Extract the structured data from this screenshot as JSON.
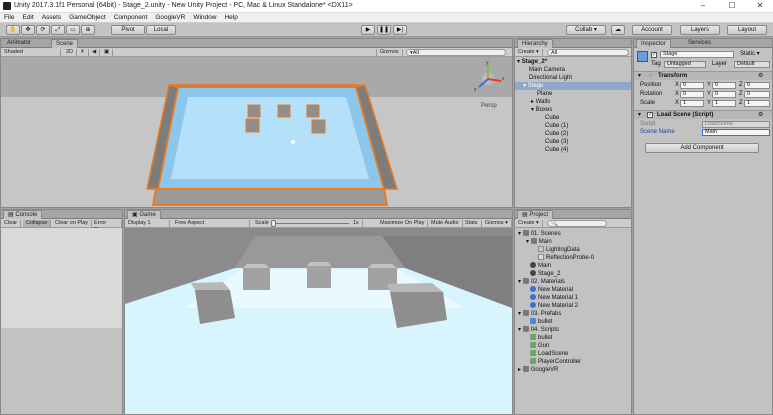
{
  "window": {
    "title": "Unity 2017.3.1f1 Personal (64bit) - Stage_2.unity - New Unity Project - PC, Mac & Linux Standalone* <DX11>",
    "minimize": "–",
    "maximize": "☐",
    "close": "✕"
  },
  "menu": [
    "File",
    "Edit",
    "Assets",
    "GameObject",
    "Component",
    "GoogleVR",
    "Window",
    "Help"
  ],
  "toolbar": {
    "pivot": "Pivot",
    "local": "Local",
    "collab": "Collab ▾",
    "account": "Account",
    "layers": "Layers",
    "layout": "Layout"
  },
  "scene": {
    "tabs": [
      "Animator",
      "Scene"
    ],
    "shading": "Shaded",
    "mode_2d": "2D",
    "gizmos": "Gizmos",
    "search": "▾All",
    "persp": "Persp",
    "axis_y": "y",
    "axis_x": "x",
    "axis_z": "z"
  },
  "hierarchy": {
    "tab": "Hierarchy",
    "create": "Create ▾",
    "search": "All",
    "items": [
      "Stage_2*",
      "Main Camera",
      "Directional Light",
      "Stage",
      "Plane",
      "Walls",
      "Boxes",
      "Cube",
      "Cube (1)",
      "Cube (2)",
      "Cube (3)",
      "Cube (4)"
    ]
  },
  "inspector": {
    "tabs": [
      "Inspector",
      "Services"
    ],
    "name": "Stage",
    "static": "Static ▾",
    "tag_label": "Tag",
    "tag": "Untagged",
    "layer_label": "Layer",
    "layer": "Default",
    "transform": {
      "title": "Transform",
      "position": {
        "label": "Position",
        "x": "0",
        "y": "0",
        "z": "0"
      },
      "rotation": {
        "label": "Rotation",
        "x": "0",
        "y": "0",
        "z": "0"
      },
      "scale": {
        "label": "Scale",
        "x": "1",
        "y": "1",
        "z": "1"
      }
    },
    "script_comp": {
      "title": "Load Scene (Script)",
      "script_label": "Script",
      "script_value": "LoadScene",
      "scene_label": "Scene Name",
      "scene_value": "Main"
    },
    "add_component": "Add Component",
    "axis_x": "X",
    "axis_y": "Y",
    "axis_z": "Z"
  },
  "console": {
    "tab": "Console",
    "buttons": [
      "Clear",
      "Collapse",
      "Clear on Play",
      "Error Pause"
    ]
  },
  "game": {
    "tab": "Game",
    "display": "Display 1",
    "aspect": "Free Aspect",
    "scale_label": "Scale",
    "scale_value": "1x",
    "buttons": [
      "Maximize On Play",
      "Mute Audio",
      "Stats",
      "Gizmos ▾"
    ]
  },
  "project": {
    "tab": "Project",
    "create": "Create ▾",
    "items": [
      "01. Scenes",
      "Main",
      "LightingData",
      "ReflectionProbe-0",
      "Main",
      "Stage_2",
      "02. Materials",
      "New Material",
      "New Material 1",
      "New Material 2",
      "03. Prefabs",
      "bullet",
      "04. Scripts",
      "bullet",
      "Gun",
      "LoadScene",
      "PlayerController",
      "GoogleVR"
    ]
  }
}
